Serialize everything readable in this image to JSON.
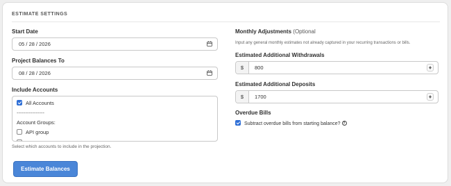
{
  "section_title": "ESTIMATE SETTINGS",
  "start_date": {
    "label": "Start Date",
    "value": "05 / 28 / 2026"
  },
  "project_to": {
    "label": "Project Balances To",
    "value": "08 / 28 / 2026"
  },
  "accounts": {
    "label": "Include Accounts",
    "items": {
      "all": "All Accounts",
      "separator": "----------------",
      "groups_header": "Account Groups:",
      "api_group": "API group",
      "cut_off": "API ... (hidden)"
    },
    "help": "Select which accounts to include in the projection."
  },
  "monthly": {
    "label": "Monthly Adjustments",
    "label_suffix": "(Optional",
    "help": "Input any general monthly estimates not already captured in your recurring transactions or bills."
  },
  "withdrawals": {
    "label": "Estimated Additional Withdrawals",
    "prefix": "$",
    "value": "800"
  },
  "deposits": {
    "label": "Estimated Additional Deposits",
    "prefix": "$",
    "value": "1700"
  },
  "overdue": {
    "label": "Overdue Bills",
    "checkbox_label": "Subtract overdue bills from starting balance?",
    "help_glyph": "?"
  },
  "submit_label": "Estimate Balances",
  "colors": {
    "primary": "#4a86d8",
    "checkbox": "#2f6fd6"
  }
}
